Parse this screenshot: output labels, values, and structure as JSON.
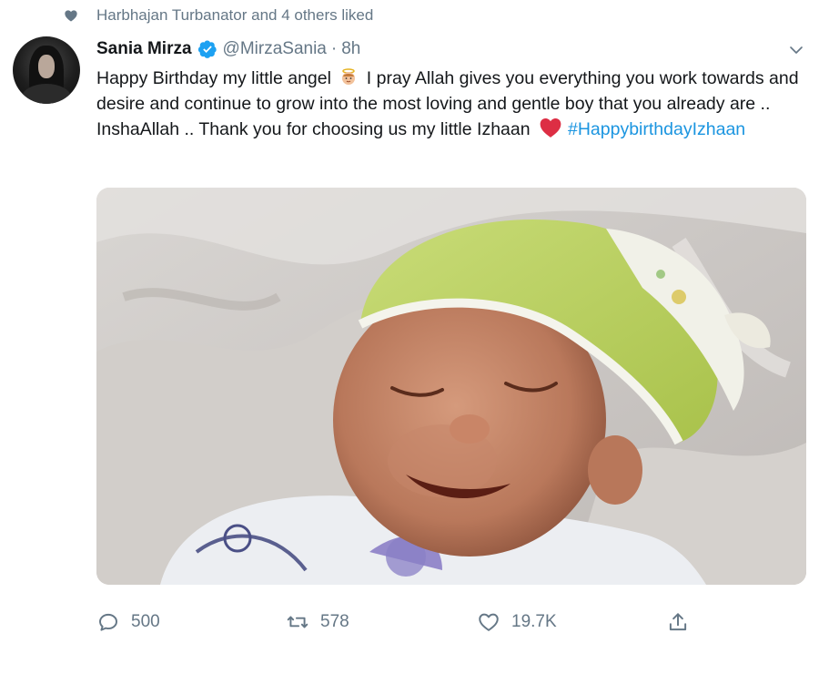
{
  "social_context": {
    "text": "Harbhajan Turbanator and 4 others liked",
    "icon": "heart-icon"
  },
  "tweet": {
    "author_name": "Sania Mirza",
    "verified_icon": "verified-badge-icon",
    "handle": "@MirzaSania",
    "separator": "·",
    "time": "8h",
    "text_part_1": "Happy Birthday my little angel",
    "angel_emoji": "baby-angel-emoji",
    "text_part_2": "I pray Allah gives you everything you work towards and desire and continue to grow into the most loving and gentle boy that you already are .. InshaAllah .. Thank you for choosing us my little Izhaan",
    "heart_emoji": "red-heart-emoji",
    "hashtag": "#HappybirthdayIzhaan",
    "media_description_icon": "photo"
  },
  "actions": {
    "reply": {
      "icon": "reply-icon",
      "count": "500"
    },
    "retweet": {
      "icon": "retweet-icon",
      "count": "578"
    },
    "like": {
      "icon": "like-heart-icon",
      "count": "19.7K"
    },
    "share": {
      "icon": "share-icon"
    }
  },
  "colors": {
    "text": "#14171a",
    "secondary": "#657786",
    "link": "#1b95e0",
    "verified": "#1da1f2",
    "heart_red": "#e0245e"
  }
}
